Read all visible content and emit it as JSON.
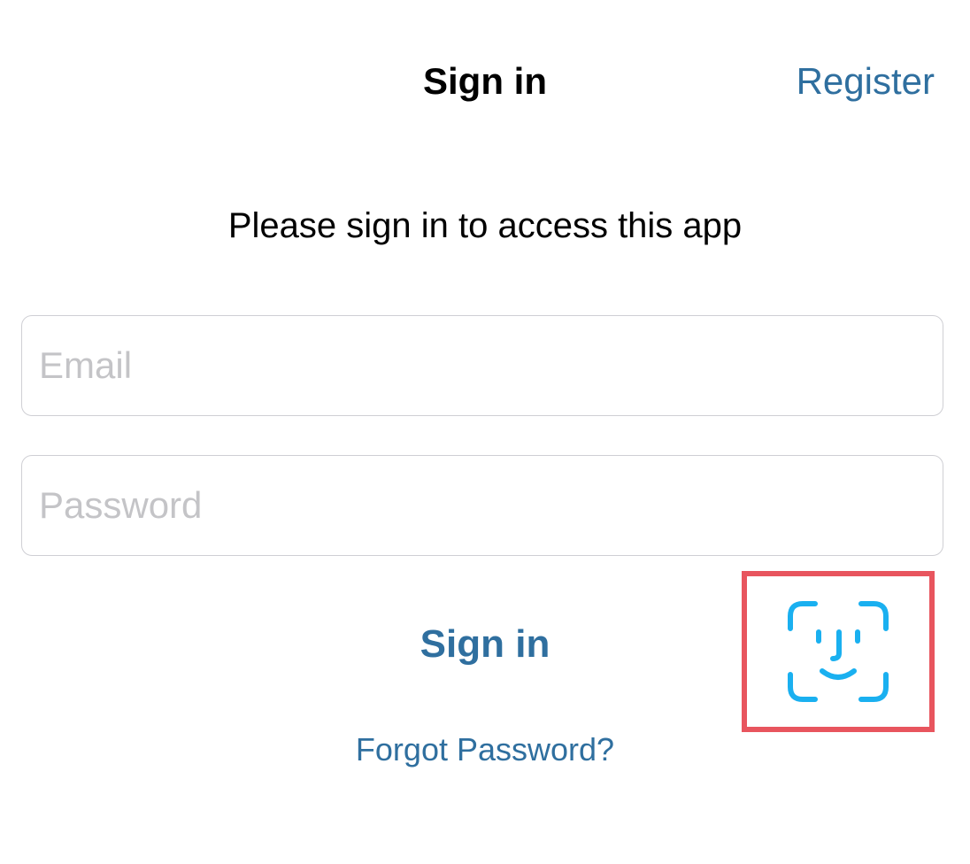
{
  "nav": {
    "title": "Sign in",
    "register_label": "Register"
  },
  "subtitle": "Please sign in to access this app",
  "form": {
    "email": {
      "value": "",
      "placeholder": "Email"
    },
    "password": {
      "value": "",
      "placeholder": "Password"
    },
    "signin_label": "Sign in",
    "forgot_label": "Forgot Password?"
  },
  "face_id": {
    "icon": "face-id-icon",
    "highlight_color": "#e8555e",
    "icon_color": "#1ab0f0"
  },
  "colors": {
    "link": "#2f6f9f",
    "placeholder": "#c4c4c7",
    "field_border": "#cfcfd4"
  }
}
